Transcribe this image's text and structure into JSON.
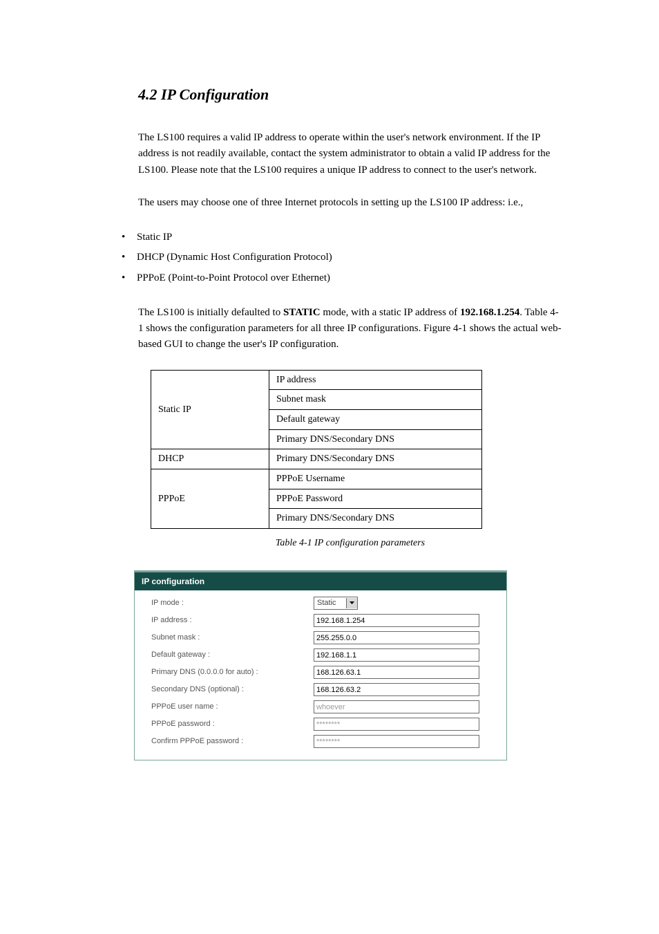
{
  "heading": "4.2 IP Configuration",
  "para1": "The LS100 requires a valid IP address to operate within the user's network environment. If the IP address is not readily available, contact the system administrator to obtain a valid IP address for the LS100. Please note that the LS100 requires a unique IP address to connect to the user's network.",
  "para2": "The users may choose one of three Internet protocols in setting up the LS100 IP address: i.e.,",
  "bullets": [
    "Static IP",
    "DHCP (Dynamic Host Configuration Protocol)",
    "PPPoE (Point-to-Point Protocol over Ethernet)"
  ],
  "para3_pre": "The LS100 is initially defaulted to ",
  "para3_bold": "STATIC",
  "para3_post": " mode, with a static IP address of ",
  "para3_ip": "192.168.1.254",
  "para3_tail": ". Table 4-1 shows the configuration parameters for all three IP configurations. Figure 4-1 shows the actual web-based GUI to change the user's IP configuration.",
  "ipmodes_table": [
    {
      "left": "Static IP",
      "rows": [
        "IP address",
        "Subnet mask",
        "Default gateway",
        "Primary DNS/Secondary DNS"
      ],
      "rowspan": 4
    },
    {
      "left": "DHCP",
      "rows": [
        "Primary DNS/Secondary DNS"
      ],
      "rowspan": 1
    },
    {
      "left": "PPPoE",
      "rows": [
        "PPPoE Username",
        "PPPoE Password",
        "Primary DNS/Secondary DNS"
      ],
      "rowspan": 3
    }
  ],
  "table_caption": "Table 4-1 IP configuration parameters",
  "config_panel": {
    "title": "IP configuration",
    "fields": [
      {
        "label": "IP mode :",
        "type": "select",
        "value": "Static",
        "disabled": false
      },
      {
        "label": "IP address :",
        "type": "text",
        "value": "192.168.1.254",
        "disabled": false
      },
      {
        "label": "Subnet mask :",
        "type": "text",
        "value": "255.255.0.0",
        "disabled": false
      },
      {
        "label": "Default gateway :",
        "type": "text",
        "value": "192.168.1.1",
        "disabled": false
      },
      {
        "label": "Primary DNS (0.0.0.0 for auto) :",
        "type": "text",
        "value": "168.126.63.1",
        "disabled": false
      },
      {
        "label": "Secondary DNS (optional) :",
        "type": "text",
        "value": "168.126.63.2",
        "disabled": false
      },
      {
        "label": "PPPoE user name :",
        "type": "text",
        "value": "whoever",
        "disabled": true
      },
      {
        "label": "PPPoE password :",
        "type": "text",
        "value": "********",
        "disabled": true
      },
      {
        "label": "Confirm PPPoE password :",
        "type": "text",
        "value": "********",
        "disabled": true
      }
    ]
  }
}
